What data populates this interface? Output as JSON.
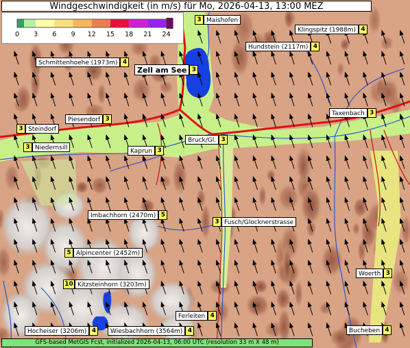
{
  "title": "Windgeschwindigkeit (in m/s) für Mo, 2026-04-13, 13:00 MEZ",
  "legend": {
    "ticks": [
      "0",
      "3",
      "6",
      "9",
      "12",
      "15",
      "18",
      "21",
      "24"
    ],
    "colors": [
      "#33a065",
      "#b6f0a6",
      "#ffffa8",
      "#f7e07a",
      "#f7b65a",
      "#f07c4e",
      "#e8103c",
      "#d01ed8",
      "#9a20ee",
      "#6a0c5c"
    ]
  },
  "stations": [
    {
      "name": "Maishofen",
      "value": "3"
    },
    {
      "name": "Klingspitz (1988m)",
      "value": "4"
    },
    {
      "name": "Hundstein (2117m)",
      "value": "4"
    },
    {
      "name": "Schmittenhoehe (1973m)",
      "value": "4"
    },
    {
      "name": "Zell am See",
      "value": "3"
    },
    {
      "name": "Taxenbach",
      "value": "3"
    },
    {
      "name": "Piesendorf",
      "value": "3"
    },
    {
      "name": "Steindorf",
      "value": "3"
    },
    {
      "name": "Bruck/Gl.",
      "value": "3"
    },
    {
      "name": "Niedernsill",
      "value": "3"
    },
    {
      "name": "Kaprun",
      "value": "3"
    },
    {
      "name": "Imbachhorn (2470m)",
      "value": "5"
    },
    {
      "name": "Fusch/Glocknerstrasse",
      "value": "3"
    },
    {
      "name": "Alpincenter (2452m)",
      "value": "5"
    },
    {
      "name": "Kitzsteinhorn (3203m)",
      "value": "10"
    },
    {
      "name": "Woerth",
      "value": "3"
    },
    {
      "name": "Ferleiten",
      "value": "4"
    },
    {
      "name": "Hocheiser (3206m)",
      "value": "4"
    },
    {
      "name": "Wiesbachhorn (3564m)",
      "value": "4"
    },
    {
      "name": "Bucheben",
      "value": "4"
    }
  ],
  "footer": "GFS-based MetGIS Fcst, initialized 2026-04-13, 06:00 UTC  (resolution 33 m X 48 m)",
  "colors": {
    "lake": "#1640e0",
    "river": "#2050d0",
    "road": "#e01010",
    "valley": "#c8f08a"
  }
}
